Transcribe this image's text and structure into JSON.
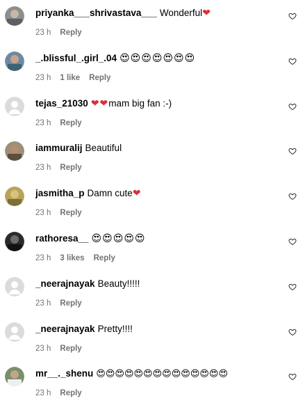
{
  "comments": [
    {
      "username": "priyanka___shrivastava___",
      "text": "Wonderful",
      "emoji": "❤",
      "time": "23 h",
      "likes": "",
      "reply": "Reply",
      "avatar_color": "#8d8e8f"
    },
    {
      "username": "_.blissful_.girl_.04",
      "text": "",
      "emoji": "😍😍😍😍😍😍😍",
      "time": "23 h",
      "likes": "1 like",
      "reply": "Reply",
      "avatar_color": "#6f8aa0"
    },
    {
      "username": "tejas_21030",
      "text": "mam big fan :-)",
      "emoji": "❤❤",
      "time": "23 h",
      "likes": "",
      "reply": "Reply",
      "avatar_color": "#d9d9d9"
    },
    {
      "username": "iammuralij",
      "text": "Beautiful",
      "emoji": "",
      "time": "23 h",
      "likes": "",
      "reply": "Reply",
      "avatar_color": "#9c8f78"
    },
    {
      "username": "jasmitha_p",
      "text": "Damn cute",
      "emoji": "❤",
      "time": "23 h",
      "likes": "",
      "reply": "Reply",
      "avatar_color": "#b7a45a"
    },
    {
      "username": "rathoresa__",
      "text": "",
      "emoji": "😍😍😍😍😍",
      "time": "23 h",
      "likes": "3 likes",
      "reply": "Reply",
      "avatar_color": "#2a2a2a"
    },
    {
      "username": "_neerajnayak",
      "text": "Beauty!!!!!",
      "emoji": "",
      "time": "23 h",
      "likes": "",
      "reply": "Reply",
      "avatar_color": "#d9d9d9"
    },
    {
      "username": "_neerajnayak",
      "text": "Pretty!!!!",
      "emoji": "",
      "time": "23 h",
      "likes": "",
      "reply": "Reply",
      "avatar_color": "#d9d9d9"
    },
    {
      "username": "mr__._shenu",
      "text": "",
      "emoji": "😍😍😍😍😍😍😍😍😍😍😍😍😍😍",
      "time": "23 h",
      "likes": "",
      "reply": "Reply",
      "avatar_color": "#7a8f6a"
    }
  ],
  "colors": {
    "meta_text": "#737373",
    "heart_emoji": "#d9303b",
    "heart_outline": "#262626"
  },
  "icons": {
    "like": "heart-outline-icon",
    "avatar": "profile-avatar-icon"
  }
}
